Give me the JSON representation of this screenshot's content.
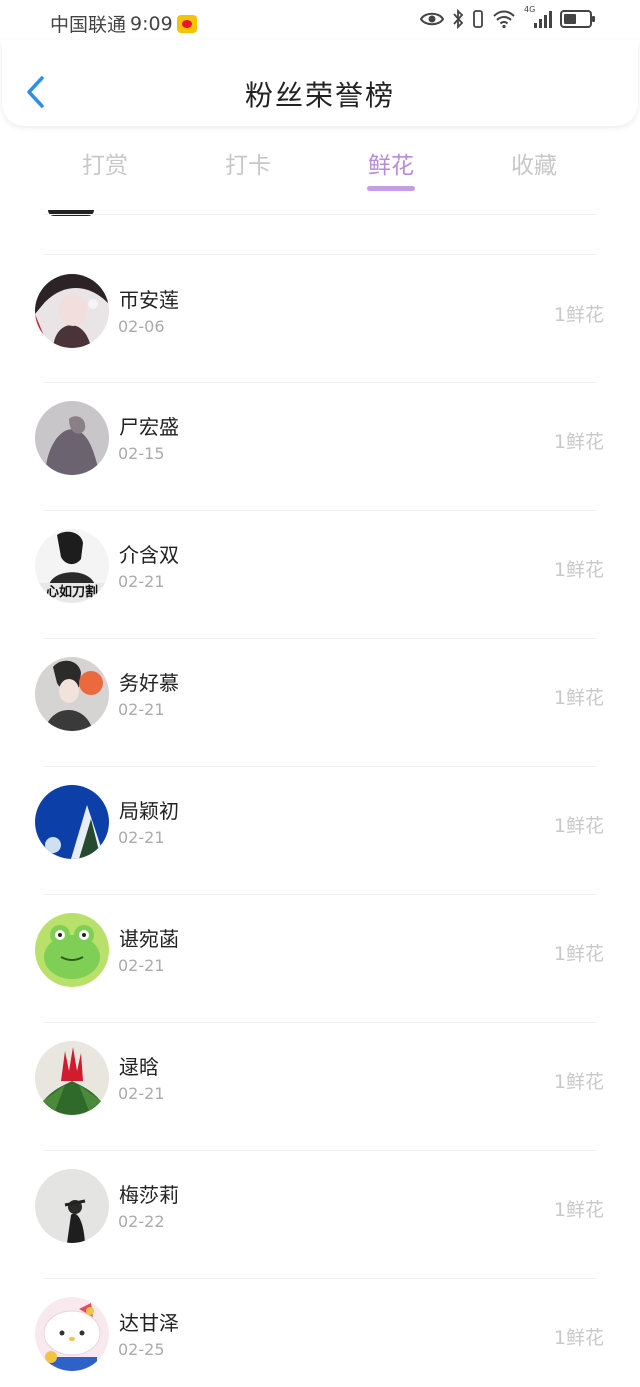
{
  "status_bar": {
    "carrier": "中国联通",
    "time": "9:09",
    "network": "4G",
    "icons": [
      "weibo-icon",
      "eye-icon",
      "bluetooth-icon",
      "vibrate-icon",
      "wifi-icon",
      "signal-icon",
      "battery-icon"
    ]
  },
  "header": {
    "title": "粉丝荣誉榜",
    "back_icon": "chevron-left-icon"
  },
  "tabs": [
    {
      "label": "打赏",
      "active": false
    },
    {
      "label": "打卡",
      "active": false
    },
    {
      "label": "鲜花",
      "active": true
    },
    {
      "label": "收藏",
      "active": false
    }
  ],
  "colors": {
    "accent": "#b98ad6",
    "underline": "#c79de4",
    "tab_inactive": "#c8c8c8",
    "back_arrow": "#2f8fe8"
  },
  "list": [
    {
      "name": "帀安莲",
      "date": "02-06",
      "gift": "1鲜花"
    },
    {
      "name": "尸宏盛",
      "date": "02-15",
      "gift": "1鲜花"
    },
    {
      "name": "介含双",
      "date": "02-21",
      "gift": "1鲜花"
    },
    {
      "name": "务好慕",
      "date": "02-21",
      "gift": "1鲜花"
    },
    {
      "name": "局颖初",
      "date": "02-21",
      "gift": "1鲜花"
    },
    {
      "name": "谌宛菡",
      "date": "02-21",
      "gift": "1鲜花"
    },
    {
      "name": "逯晗",
      "date": "02-21",
      "gift": "1鲜花"
    },
    {
      "name": "梅莎莉",
      "date": "02-22",
      "gift": "1鲜花"
    },
    {
      "name": "达甘泽",
      "date": "02-25",
      "gift": "1鲜花"
    }
  ],
  "avatar_overlay_text": "心如刀割"
}
